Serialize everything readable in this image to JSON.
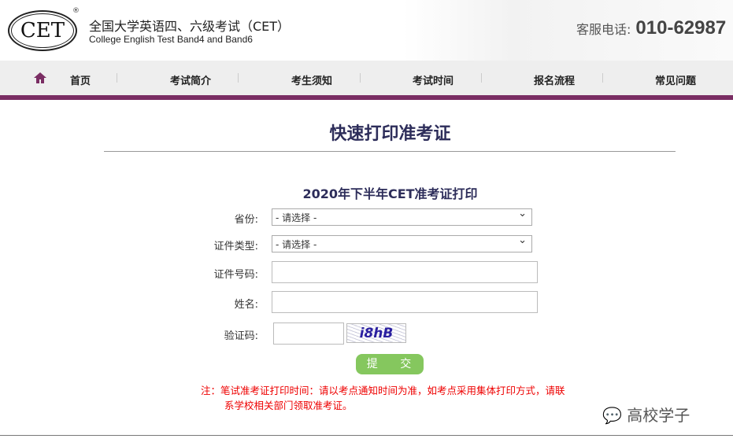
{
  "header": {
    "logo_text": "CET",
    "title_cn": "全国大学英语四、六级考试（CET）",
    "title_en": "College English Test Band4 and Band6",
    "phone_label": "客服电话:",
    "phone_number": "010-62987"
  },
  "nav": {
    "items": [
      {
        "label": "首页"
      },
      {
        "label": "考试简介"
      },
      {
        "label": "考生须知"
      },
      {
        "label": "考试时间"
      },
      {
        "label": "报名流程"
      },
      {
        "label": "常见问题"
      }
    ]
  },
  "colors": {
    "accent": "#7a2d63",
    "submit": "#85c75e",
    "note": "#e00000"
  },
  "page": {
    "title": "快速打印准考证",
    "form_title": "2020年下半年CET准考证打印"
  },
  "form": {
    "province_label": "省份:",
    "province_value": "- 请选择 -",
    "idtype_label": "证件类型:",
    "idtype_value": "- 请选择 -",
    "idnum_label": "证件号码:",
    "name_label": "姓名:",
    "captcha_label": "验证码:",
    "captcha_text": "i8hB",
    "submit": "提 交"
  },
  "note": {
    "line1": "注：笔试准考证打印时间：请以考点通知时间为准，如考点采用集体打印方式，请联",
    "line2": "系学校相关部门领取准考证。"
  },
  "watermark": "高校学子"
}
